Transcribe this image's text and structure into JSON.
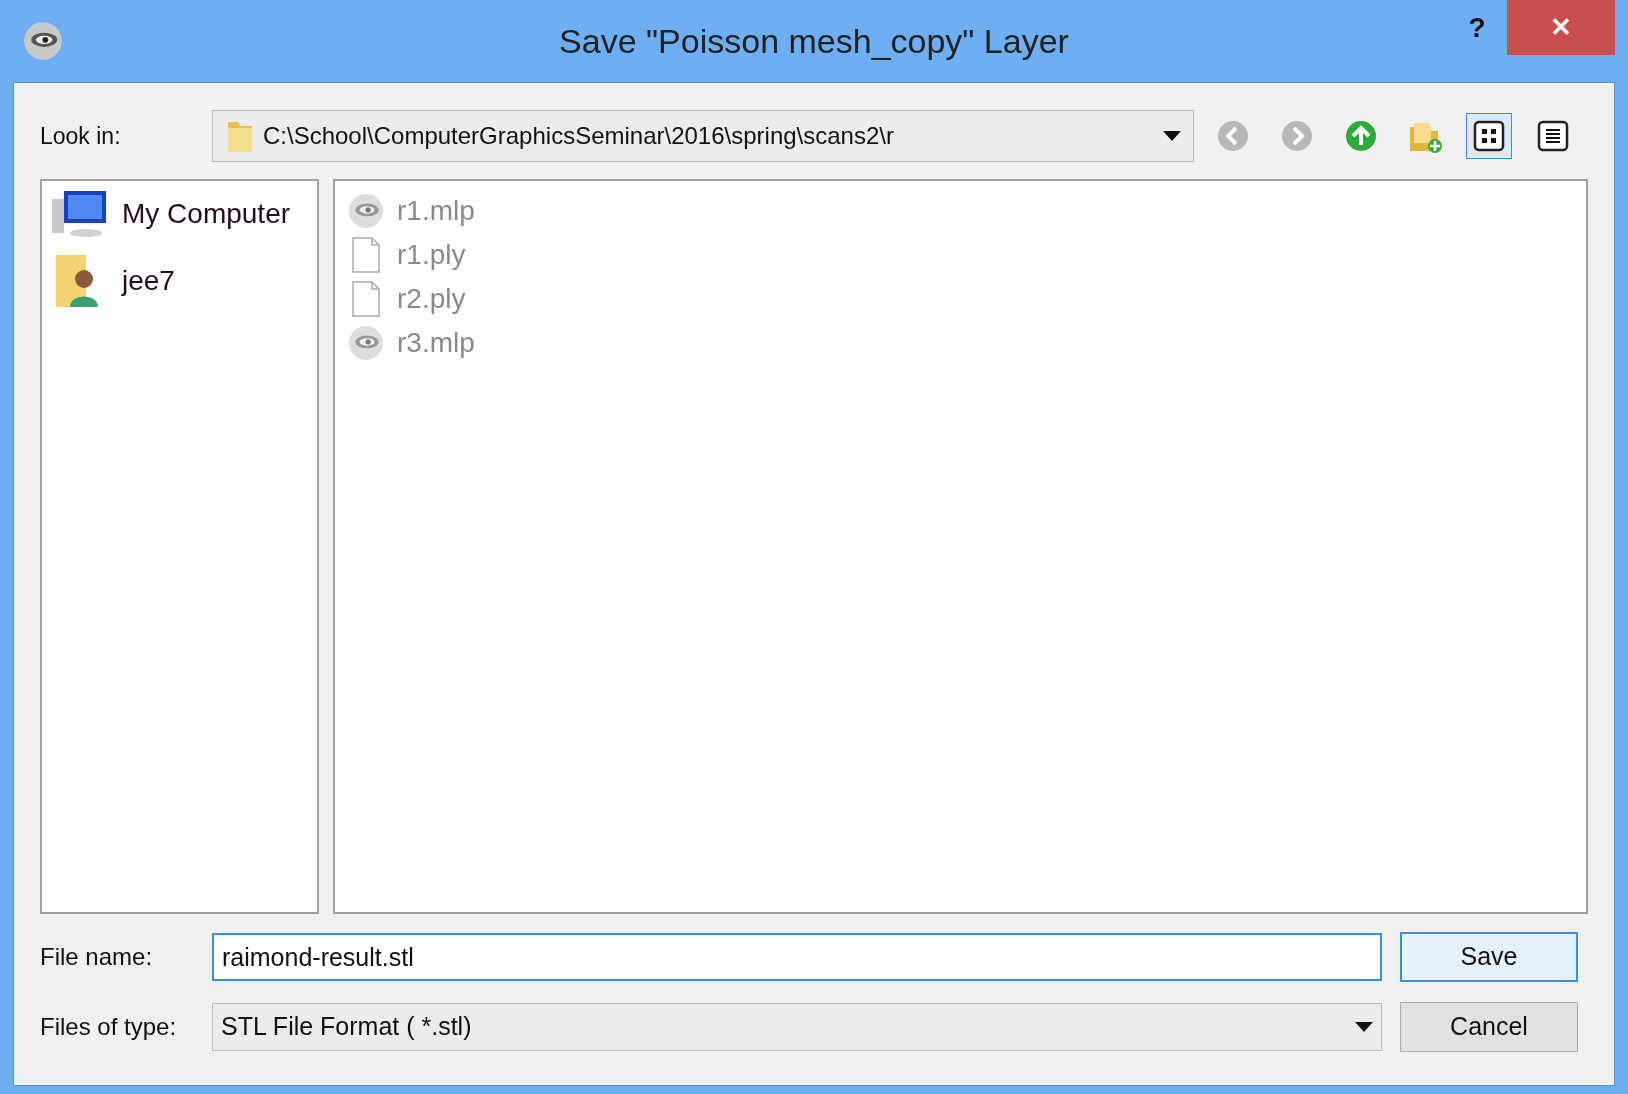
{
  "window": {
    "title": "Save \"Poisson mesh_copy\" Layer",
    "help": "?",
    "close": "✕"
  },
  "look_in": {
    "label": "Look in:",
    "path": "C:\\School\\ComputerGraphicsSeminar\\2016\\spring\\scans2\\r"
  },
  "toolbar": [
    {
      "kind": "back",
      "disabled": true
    },
    {
      "kind": "forward",
      "disabled": true
    },
    {
      "kind": "up",
      "disabled": false
    },
    {
      "kind": "new-folder",
      "disabled": false
    },
    {
      "kind": "list-view",
      "selected": true
    },
    {
      "kind": "detail-view",
      "selected": false
    }
  ],
  "sidebar": {
    "items": [
      {
        "kind": "computer",
        "label": "My Computer"
      },
      {
        "kind": "user",
        "label": "jee7"
      }
    ]
  },
  "files": [
    {
      "kind": "mlp",
      "name": "r1.mlp",
      "disabled": true
    },
    {
      "kind": "ply",
      "name": "r1.ply",
      "disabled": true
    },
    {
      "kind": "ply",
      "name": "r2.ply",
      "disabled": true
    },
    {
      "kind": "mlp",
      "name": "r3.mlp",
      "disabled": true
    }
  ],
  "file_name": {
    "label": "File name:",
    "value": "raimond-result.stl"
  },
  "file_type": {
    "label": "Files of type:",
    "value": "STL File Format ( *.stl)"
  },
  "buttons": [
    {
      "label": "Save",
      "default": true
    },
    {
      "label": "Cancel",
      "default": false
    }
  ]
}
